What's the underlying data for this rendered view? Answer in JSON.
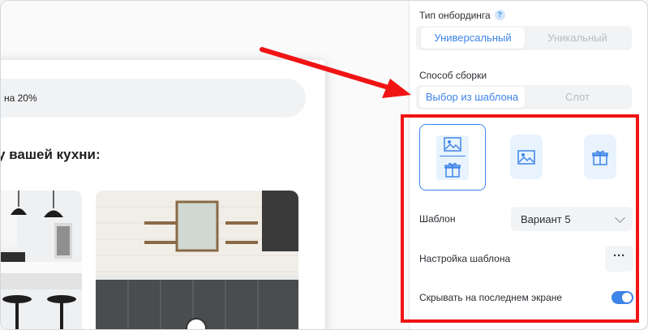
{
  "preview": {
    "promo_text": "на 20%",
    "question": "у вашей кухни:"
  },
  "panel": {
    "onboarding_type": {
      "label": "Тип онбординга",
      "help_icon": "?",
      "options": [
        "Универсальный",
        "Уникальный"
      ],
      "selected": "Универсальный"
    },
    "build_method": {
      "label": "Способ сборки",
      "options": [
        "Выбор из шаблона",
        "Слот"
      ],
      "selected": "Выбор из шаблона"
    },
    "template_types": [
      {
        "icon": "image-and-gift-icon",
        "selected": true
      },
      {
        "icon": "image-icon",
        "selected": false
      },
      {
        "icon": "gift-icon",
        "selected": false
      }
    ],
    "template": {
      "label": "Шаблон",
      "value": "Вариант 5"
    },
    "template_settings": {
      "label": "Настройка шаблона",
      "button": "···"
    },
    "hide_last": {
      "label": "Скрывать на последнем экране",
      "on": true
    }
  },
  "colors": {
    "accent": "#3d84e8",
    "annotation": "#f01414"
  }
}
